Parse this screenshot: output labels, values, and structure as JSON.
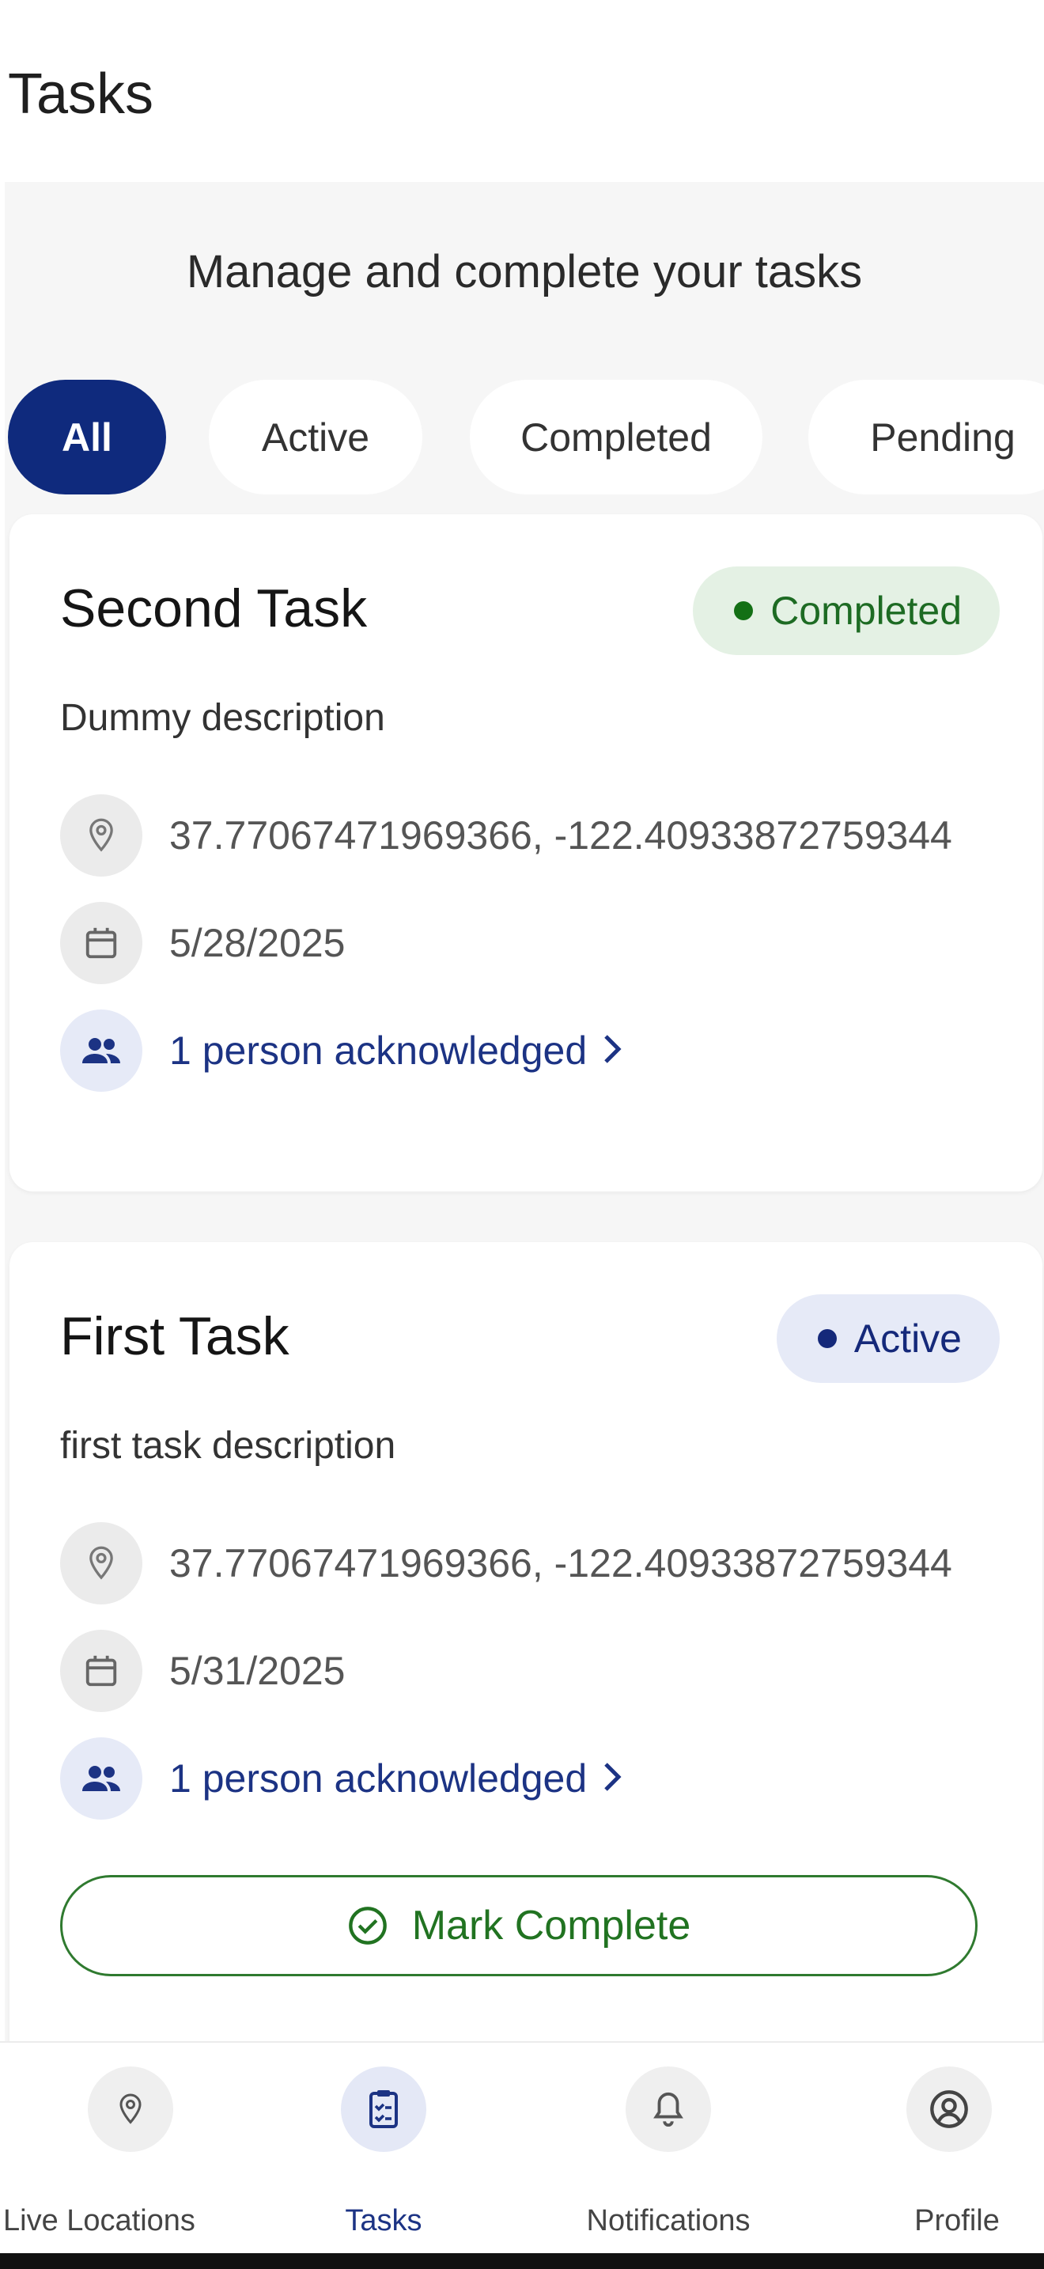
{
  "header": {
    "title": "Tasks"
  },
  "subtitle": "Manage and complete your tasks",
  "filters": [
    {
      "label": "All",
      "selected": true
    },
    {
      "label": "Active",
      "selected": false
    },
    {
      "label": "Completed",
      "selected": false
    },
    {
      "label": "Pending",
      "selected": false
    }
  ],
  "tasks": [
    {
      "title": "Second Task",
      "status": "Completed",
      "description": "Dummy description",
      "location": "37.77067471969366, -122.40933872759344",
      "date": "5/28/2025",
      "acknowledged": "1 person acknowledged"
    },
    {
      "title": "First Task",
      "status": "Active",
      "description": "first task description",
      "location": "37.77067471969366, -122.40933872759344",
      "date": "5/31/2025",
      "acknowledged": "1 person acknowledged",
      "action_label": "Mark Complete"
    }
  ],
  "bottom_nav": [
    {
      "label": "Live Locations",
      "icon": "location-pin-icon",
      "active": false
    },
    {
      "label": "Tasks",
      "icon": "clipboard-icon",
      "active": true
    },
    {
      "label": "Notifications",
      "icon": "bell-icon",
      "active": false
    },
    {
      "label": "Profile",
      "icon": "account-circle-icon",
      "active": false
    }
  ],
  "colors": {
    "primary": "#0f2a7d",
    "completed_green": "#137015",
    "completed_bg": "#e4f1e4",
    "active_bg": "#e6eaf7",
    "page_bg": "#f6f6f6"
  }
}
